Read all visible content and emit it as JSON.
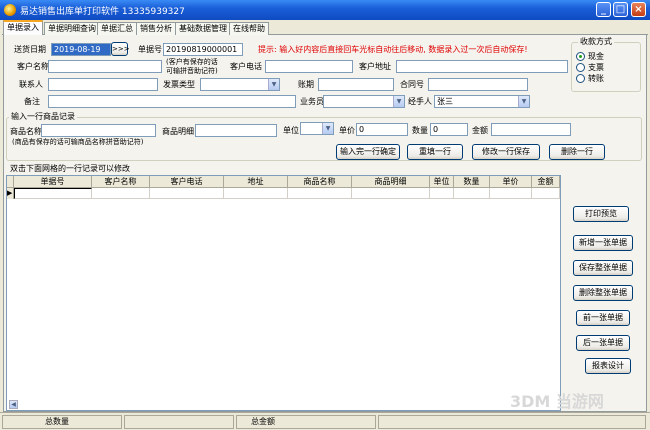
{
  "window": {
    "title": "易达销售出库单打印软件 13335939327",
    "min_label": "_",
    "max_label": "□",
    "close_label": "×"
  },
  "tabs": [
    {
      "label": "单据录入",
      "active": true
    },
    {
      "label": "单据明细查询",
      "active": false
    },
    {
      "label": "单据汇总",
      "active": false
    },
    {
      "label": "销售分析",
      "active": false
    },
    {
      "label": "基础数据管理",
      "active": false
    },
    {
      "label": "在线帮助",
      "active": false
    }
  ],
  "form": {
    "ship_date_label": "送货日期",
    "ship_date_value": "2019-08-19",
    "date_picker_label": ">>>",
    "doc_no_label": "单据号",
    "doc_no_value": "20190819000001",
    "hint": "提示: 输入好内容后直接回车光标自动往后移动, 数据录入过一次后自动保存!",
    "customer_name_label": "客户名称",
    "customer_name_value": "",
    "customer_note": "(客户有保存的话可输拼音助记符)",
    "customer_phone_label": "客户电话",
    "customer_phone_value": "",
    "customer_addr_label": "客户地址",
    "customer_addr_value": "",
    "contact_label": "联系人",
    "contact_value": "",
    "invoice_type_label": "发票类型",
    "invoice_type_value": "",
    "account_period_label": "账期",
    "account_period_value": "",
    "contract_no_label": "合同号",
    "contract_no_value": "",
    "remark_label": "备注",
    "remark_value": "",
    "salesman_label": "业务员",
    "salesman_value": "",
    "handler_label": "经手人",
    "handler_value": "张三"
  },
  "payment": {
    "caption": "收款方式",
    "options": [
      {
        "label": "现金",
        "checked": true
      },
      {
        "label": "支票",
        "checked": false
      },
      {
        "label": "转账",
        "checked": false
      }
    ]
  },
  "item_entry": {
    "caption": "输入一行商品记录",
    "product_name_label": "商品名称",
    "product_name_value": "",
    "product_note": "(商品有保存的话可输商品名称拼音助记符)",
    "product_detail_label": "商品明细",
    "product_detail_value": "",
    "unit_label": "单位",
    "unit_value": "",
    "price_label": "单价",
    "price_value": "0",
    "qty_label": "数量",
    "qty_value": "0",
    "amount_label": "金额",
    "amount_value": "",
    "btn_confirm": "输入完一行确定",
    "btn_refill": "重填一行",
    "btn_save_row": "修改一行保存",
    "btn_delete_row": "删除一行"
  },
  "grid": {
    "caption": "双击下面网格的一行记录可以修改",
    "columns": [
      "单据号",
      "客户名称",
      "客户电话",
      "地址",
      "商品名称",
      "商品明细",
      "单位",
      "数量",
      "单价",
      "金额"
    ],
    "current_row_marker": "▶"
  },
  "side_buttons": {
    "print_preview": "打印预览",
    "new_doc": "新增一张单据",
    "save_doc": "保存整张单据",
    "delete_doc": "删除整张单据",
    "prev_doc": "前一张单据",
    "next_doc": "后一张单据",
    "report_design": "报表设计"
  },
  "status": {
    "total_qty_label": "总数量",
    "total_amount_label": "总金额"
  },
  "watermark": "3DM 当游网"
}
